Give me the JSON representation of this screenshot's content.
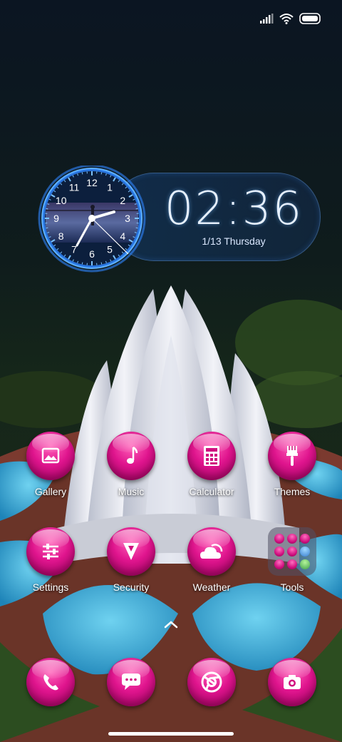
{
  "status_bar": {
    "icons": [
      "signal-icon",
      "wifi-icon",
      "battery-icon"
    ]
  },
  "clock_widget": {
    "time": "02:36",
    "date": "1/13 Thursday",
    "dial_numbers": [
      "12",
      "1",
      "2",
      "3",
      "4",
      "5",
      "6",
      "7",
      "8",
      "9",
      "10",
      "11"
    ],
    "accent_color": "#3a9bff"
  },
  "apps": {
    "row1": [
      {
        "label": "Gallery",
        "icon": "gallery-icon"
      },
      {
        "label": "Music",
        "icon": "music-note-icon"
      },
      {
        "label": "Calculator",
        "icon": "calculator-icon"
      },
      {
        "label": "Themes",
        "icon": "paintbrush-icon"
      }
    ],
    "row2": [
      {
        "label": "Settings",
        "icon": "sliders-icon"
      },
      {
        "label": "Security",
        "icon": "shield-icon"
      },
      {
        "label": "Weather",
        "icon": "cloud-sun-icon"
      },
      {
        "label": "Tools",
        "icon": "folder-icon"
      }
    ]
  },
  "dock": [
    {
      "icon": "phone-icon"
    },
    {
      "icon": "message-icon"
    },
    {
      "icon": "browser-icon"
    },
    {
      "icon": "camera-icon"
    }
  ],
  "colors": {
    "icon_pink": "#e0158e",
    "icon_pink_light": "#ff5fb8",
    "widget_blue": "#3a9bff"
  }
}
